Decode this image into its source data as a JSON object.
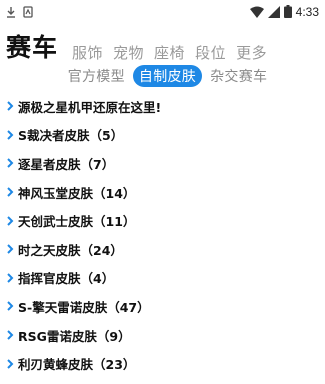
{
  "status_bar": {
    "time": "4:33",
    "left_icons": [
      "download-icon",
      "notification-icon"
    ],
    "right_icons": [
      "wifi-icon",
      "cellular-icon",
      "battery-icon"
    ]
  },
  "top_tabs": [
    {
      "label": "赛车",
      "active": true
    },
    {
      "label": "服饰",
      "active": false
    },
    {
      "label": "宠物",
      "active": false
    },
    {
      "label": "座椅",
      "active": false
    },
    {
      "label": "段位",
      "active": false
    },
    {
      "label": "更多",
      "active": false
    }
  ],
  "sub_tabs": [
    {
      "label": "官方模型",
      "active": false
    },
    {
      "label": "自制皮肤",
      "active": true
    },
    {
      "label": "杂交赛车",
      "active": false
    }
  ],
  "colors": {
    "accent": "#1e88e5",
    "inactive": "#9a9a9a"
  },
  "skin_list": [
    {
      "label": "源极之星机甲还原在这里!"
    },
    {
      "label": "S裁决者皮肤（5）"
    },
    {
      "label": "逐星者皮肤（7）"
    },
    {
      "label": "神风玉堂皮肤（14）"
    },
    {
      "label": "天创武士皮肤（11）"
    },
    {
      "label": "时之天皮肤（24）"
    },
    {
      "label": "指挥官皮肤（4）"
    },
    {
      "label": "S-擎天雷诺皮肤（47）"
    },
    {
      "label": "RSG雷诺皮肤（9）"
    },
    {
      "label": "利刃黄蜂皮肤（23）"
    }
  ]
}
